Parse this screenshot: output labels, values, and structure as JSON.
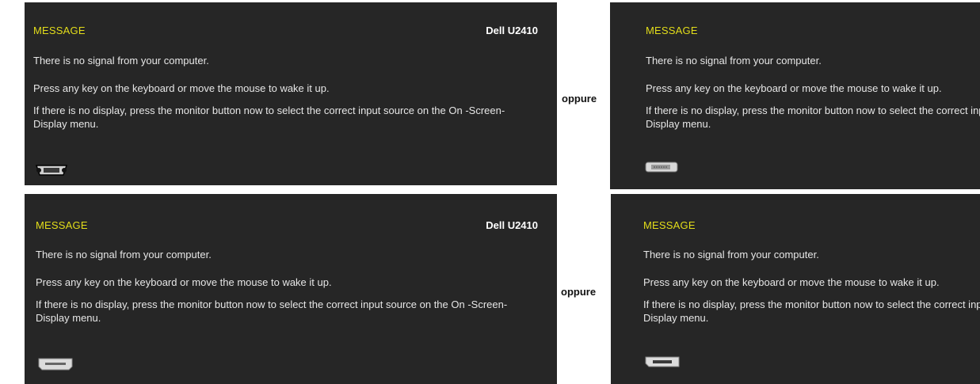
{
  "separator": "oppure",
  "panels": [
    {
      "title": "MESSAGE",
      "model": "Dell U2410",
      "line1": "There is no signal from your computer.",
      "line2": "Press any key on the keyboard or move the mouse to wake it up.",
      "line3": "If there is no display, press the monitor button now to select the correct input source on the On -Screen-Display menu.",
      "connector_icon": "vga-connector-icon"
    },
    {
      "title": "MESSAGE",
      "line1": "There is no signal from your computer.",
      "line2": "Press any key on the keyboard or move the mouse to wake it up.",
      "line3": "If there is no display, press the monitor button now to select the correct input source on the On -Screen-Display menu.",
      "connector_icon": "dvi-connector-icon"
    },
    {
      "title": "MESSAGE",
      "model": "Dell U2410",
      "line1": "There is no signal from your computer.",
      "line2": "Press any key on the keyboard or move the mouse to wake it up.",
      "line3": "If there is no display, press the monitor button now to select the correct input source on the On -Screen-Display menu.",
      "connector_icon": "hdmi-connector-icon"
    },
    {
      "title": "MESSAGE",
      "line1": "There is no signal from your computer.",
      "line2": "Press any key on the keyboard or move the mouse to wake it up.",
      "line3": "If there is no display, press the monitor button now to select the correct input source on the On -Screen-Display menu.",
      "connector_icon": "displayport-connector-icon"
    }
  ],
  "colors": {
    "panel_bg": "#262626",
    "title": "#e3dd1a",
    "text": "#e6e6e6"
  }
}
